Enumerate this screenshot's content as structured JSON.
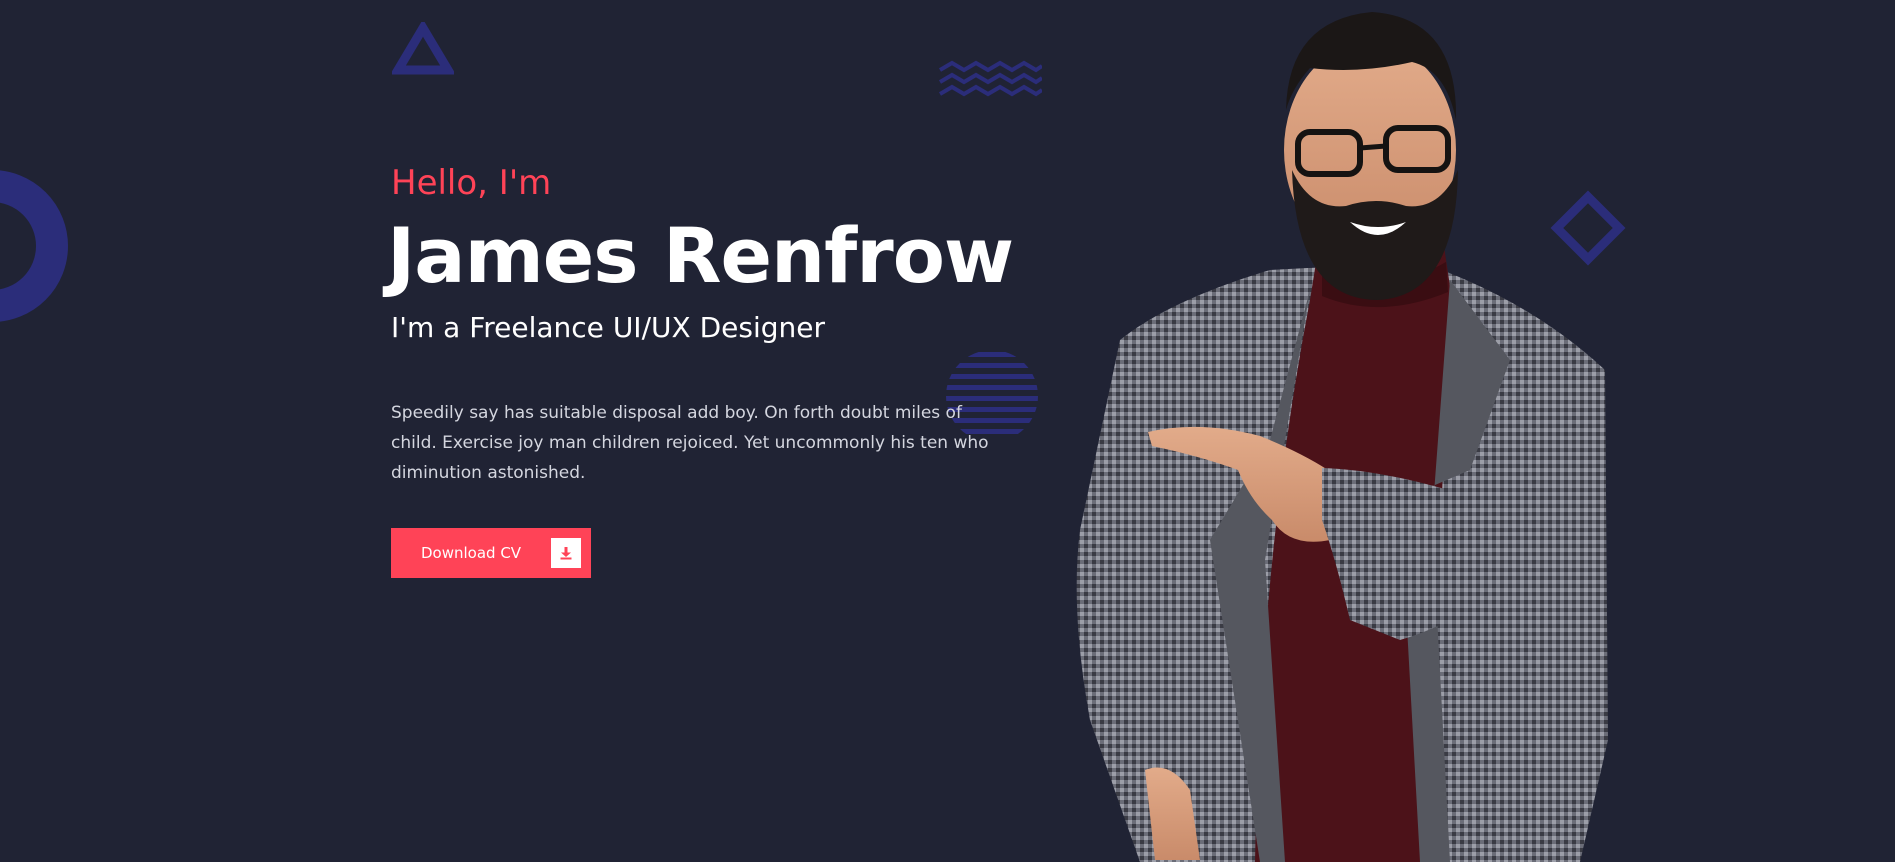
{
  "hero": {
    "greeting": "Hello, I'm",
    "name": "James Renfrow",
    "role": "I'm a Freelance UI/UX Designer",
    "description": "Speedily say has suitable disposal add boy. On forth doubt miles of child. Exercise joy man children rejoiced. Yet uncommonly his ten who diminution astonished.",
    "cta_label": "Download CV",
    "cta_icon": "download-icon"
  },
  "colors": {
    "background": "#202334",
    "accent": "#ff4357",
    "decoration": "#2b2d7a",
    "text": "#ffffff",
    "muted_text": "#d4d6df"
  }
}
